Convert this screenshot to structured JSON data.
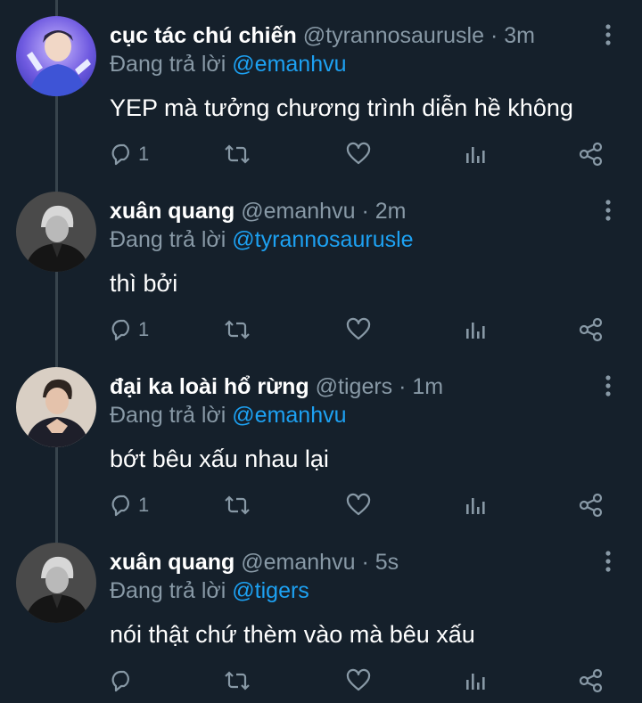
{
  "tweets": [
    {
      "display_name": "cục tác chú chiến",
      "handle": "@tyrannosaurusle",
      "separator": "·",
      "time": "3m",
      "reply_prefix": "Đang trả lời",
      "reply_to": "@emanhvu",
      "text": "YEP mà tưởng chương trình diễn hề không",
      "reply_count": "1"
    },
    {
      "display_name": "xuân quang",
      "handle": "@emanhvu",
      "separator": "·",
      "time": "2m",
      "reply_prefix": "Đang trả lời",
      "reply_to": "@tyrannosaurusle",
      "text": "thì bởi",
      "reply_count": "1"
    },
    {
      "display_name": "đại ka loài hổ rừng",
      "handle": "@tigers",
      "separator": "·",
      "time": "1m",
      "reply_prefix": "Đang trả lời",
      "reply_to": "@emanhvu",
      "text": "bớt bêu xấu nhau lại",
      "reply_count": "1"
    },
    {
      "display_name": "xuân quang",
      "handle": "@emanhvu",
      "separator": "·",
      "time": "5s",
      "reply_prefix": "Đang trả lời",
      "reply_to": "@tigers",
      "text": "nói thật chứ thèm vào mà bêu xấu",
      "reply_count": ""
    }
  ],
  "icons": {
    "reply": "reply-icon",
    "retweet": "retweet-icon",
    "like": "heart-icon",
    "stats": "analytics-icon",
    "share": "share-icon",
    "more": "more-vertical-icon"
  },
  "colors": {
    "background": "#15202b",
    "primary_text": "#ffffff",
    "secondary_text": "#8899a6",
    "link": "#1da1f2",
    "thread_line": "#38444d"
  }
}
